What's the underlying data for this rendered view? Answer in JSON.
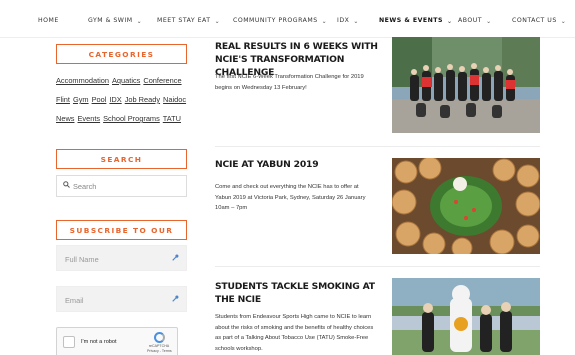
{
  "nav": {
    "items": [
      {
        "label": "HOME",
        "dropdown": false
      },
      {
        "label": "GYM & SWIM",
        "dropdown": true
      },
      {
        "label": "MEET STAY EAT",
        "dropdown": true
      },
      {
        "label": "COMMUNITY PROGRAMS",
        "dropdown": true
      },
      {
        "label": "IDX",
        "dropdown": true
      },
      {
        "label": "NEWS & EVENTS",
        "dropdown": true,
        "active": true
      },
      {
        "label": "ABOUT",
        "dropdown": true
      },
      {
        "label": "CONTACT US",
        "dropdown": true
      }
    ]
  },
  "sidebar": {
    "categories_title": "CATEGORIES",
    "categories": [
      [
        "Accommodation",
        "Aquatics",
        "Conference"
      ],
      [
        "Flint",
        "Gym",
        "Pool",
        "IDX",
        "Job Ready",
        "Naidoc"
      ],
      [
        "News",
        "Events",
        "School Programs",
        "TATU"
      ]
    ],
    "search_title": "SEARCH",
    "search_placeholder": "Search",
    "subscribe_title": "SUBSCRIBE TO OUR NEWS",
    "fullname_placeholder": "Full Name",
    "email_placeholder": "Email",
    "captcha_label": "I'm not a robot",
    "captcha_brand": "reCAPTCHA",
    "captcha_links": "Privacy - Terms"
  },
  "posts": [
    {
      "title": "REAL RESULTS IN 6 WEEKS WITH NCIE'S TRANSFORMATION CHALLENGE",
      "excerpt": "The first NCIE 6-Week Transformation Challenge for 2019 begins on Wednesday 13 February!"
    },
    {
      "title": "NCIE AT YABUN 2019",
      "excerpt": "Come and check out everything the NCIE has to offer at Yabun 2019 at Victoria Park, Sydney, Saturday 26 January 10am – 7pm"
    },
    {
      "title": "STUDENTS TACKLE SMOKING AT THE NCIE",
      "excerpt": "Students from Endeavour Sports High came to NCIE to learn about the risks of smoking and the benefits of healthy choices as part of a Talking About Tobacco Use (TATU) Smoke-Free schools workshop."
    }
  ],
  "colors": {
    "accent": "#e8652e",
    "key_icon": "#4f86c6"
  }
}
